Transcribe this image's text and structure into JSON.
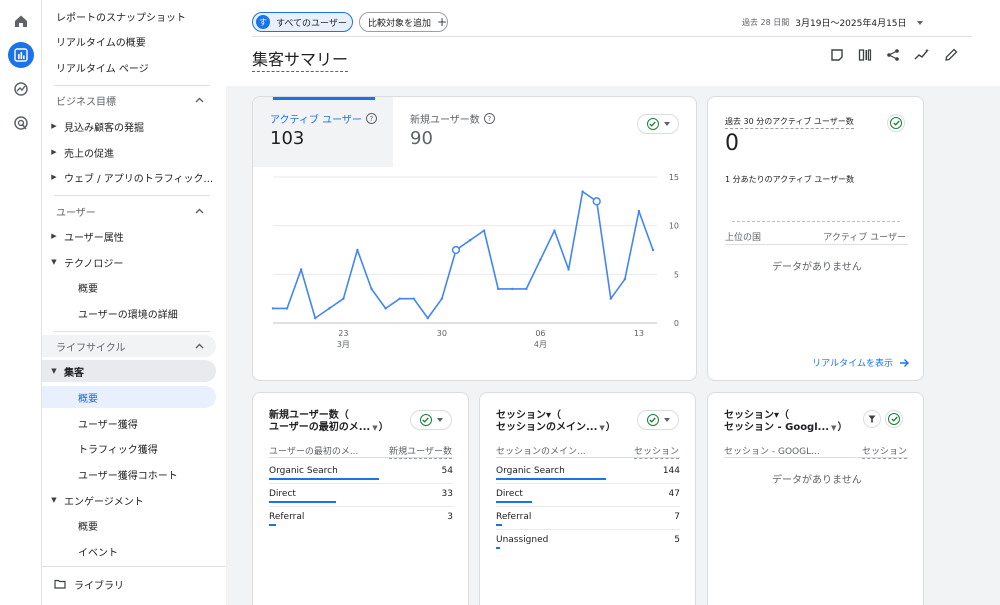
{
  "nav": {
    "items": [
      {
        "label": "レポートのスナップショット"
      },
      {
        "label": "リアルタイムの概要"
      },
      {
        "label": "リアルタイム ページ"
      }
    ],
    "sections": [
      {
        "label": "ビジネス目標"
      },
      {
        "label": "ユーザー"
      },
      {
        "label": "ライフサイクル"
      }
    ],
    "business_items": [
      {
        "label": "見込み顧客の発掘"
      },
      {
        "label": "売上の促進"
      },
      {
        "label": "ウェブ / アプリのトラフィック..."
      }
    ],
    "user_items": [
      {
        "label": "ユーザー属性"
      },
      {
        "label": "テクノロジー"
      }
    ],
    "tech_sub": [
      {
        "label": "概要"
      },
      {
        "label": "ユーザーの環境の詳細"
      }
    ],
    "acq_group": {
      "label": "集客"
    },
    "acq_sub": [
      {
        "label": "概要"
      },
      {
        "label": "ユーザー獲得"
      },
      {
        "label": "トラフィック獲得"
      },
      {
        "label": "ユーザー獲得コホート"
      }
    ],
    "eng_group": {
      "label": "エンゲージメント"
    },
    "eng_sub": [
      {
        "label": "概要"
      },
      {
        "label": "イベント"
      }
    ],
    "library": {
      "label": "ライブラリ"
    }
  },
  "header": {
    "segment_chip": "すべてのユーザー",
    "segment_avatar": "す",
    "compare_chip": "比較対象を追加",
    "date_prefix": "過去 28 日間",
    "date_range": "3月19日～2025年4月15日",
    "page_title": "集客サマリー"
  },
  "colors": {
    "accent": "#1a73e8",
    "check": "#188038"
  },
  "card_main": {
    "metric1": {
      "label": "アクティブ ユーザー",
      "value": "103"
    },
    "metric2": {
      "label": "新規ユーザー数",
      "value": "90"
    }
  },
  "chart_data": {
    "type": "line",
    "x": [
      "3月17日",
      "3月18日",
      "3月19日",
      "3月20日",
      "3月21日",
      "3月22日",
      "3月23日",
      "3月24日",
      "3月25日",
      "3月26日",
      "3月27日",
      "3月28日",
      "3月29日",
      "3月30日",
      "3月31日",
      "4月1日",
      "4月2日",
      "4月3日",
      "4月4日",
      "4月5日",
      "4月6日",
      "4月7日",
      "4月8日",
      "4月9日",
      "4月10日",
      "4月11日",
      "4月12日",
      "4月13日"
    ],
    "series": [
      {
        "values": [
          1.5,
          1.5,
          5.5,
          0.5,
          1.5,
          2.5,
          7.5,
          3.5,
          1.5,
          2.5,
          2.5,
          0.5,
          2.5,
          7.5,
          8.5,
          9.5,
          3.5,
          3.5,
          3.5,
          6.5,
          9.5,
          5.5,
          13.5,
          12.5,
          2.5,
          4.5,
          11.5,
          7.5
        ]
      }
    ],
    "x_ticks": [
      {
        "day": "23",
        "month": "3月"
      },
      {
        "day": "30",
        "month": ""
      },
      {
        "day": "06",
        "month": "4月"
      },
      {
        "day": "13",
        "month": ""
      }
    ],
    "y_ticks": [
      "15",
      "10",
      "5",
      "0"
    ],
    "ylim": [
      0,
      15
    ],
    "grid": true
  },
  "realtime": {
    "title": "過去 30 分のアクティブ ユーザー数",
    "value": "0",
    "sub": "1 分あたりのアクティブ ユーザー数",
    "col1": "上位の国",
    "col2": "アクティブ ユーザー",
    "nodata": "データがありません",
    "link": "リアルタイムを表示"
  },
  "card_new_users": {
    "title_line1": "新規ユーザー数（",
    "title_line2": "ユーザーの最初のメ...",
    "col1": "ユーザーの最初のメ...",
    "col2": "新規ユーザー数",
    "rows": [
      {
        "name": "Organic Search",
        "value": "54",
        "share": 1.0
      },
      {
        "name": "Direct",
        "value": "33",
        "share": 0.61
      },
      {
        "name": "Referral",
        "value": "3",
        "share": 0.06
      }
    ]
  },
  "card_sessions": {
    "title_line1": "セッション▾（",
    "title_line2": "セッションのメイン...",
    "col1": "セッションのメイン...",
    "col2": "セッション",
    "rows": [
      {
        "name": "Organic Search",
        "value": "144",
        "share": 1.0
      },
      {
        "name": "Direct",
        "value": "47",
        "share": 0.33
      },
      {
        "name": "Referral",
        "value": "7",
        "share": 0.05
      },
      {
        "name": "Unassigned",
        "value": "5",
        "share": 0.03
      }
    ]
  },
  "card_sessions_google": {
    "title_line1": "セッション▾（",
    "title_line2": "セッション - Googl...",
    "col1": "セッション - GOOGL...",
    "col2": "セッション",
    "nodata": "データがありません"
  }
}
